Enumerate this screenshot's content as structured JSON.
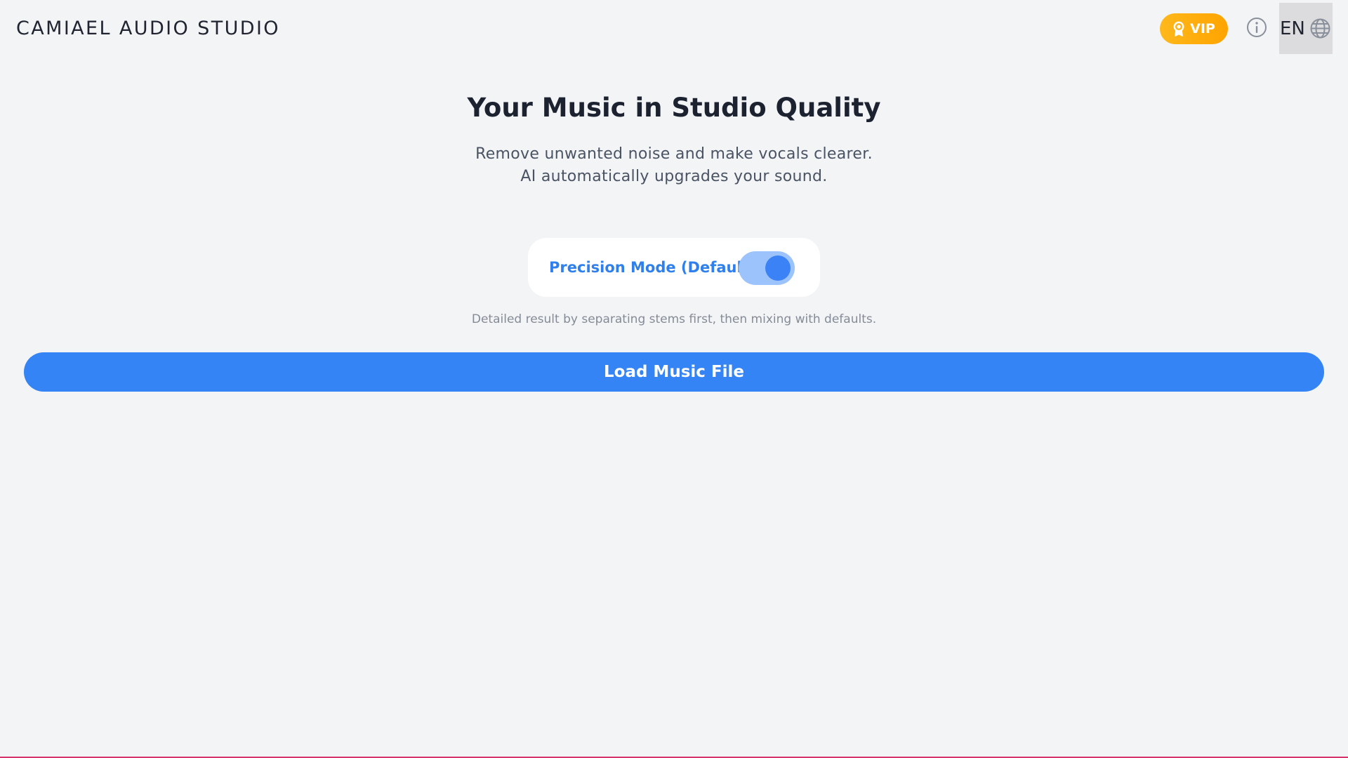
{
  "header": {
    "app_title": "CAMIAEL AUDIO STUDIO",
    "vip_label": "VIP",
    "vip_icon": "award-icon",
    "info_icon": "info-icon",
    "language_code": "EN",
    "language_icon": "globe-icon"
  },
  "hero": {
    "title": "Your Music in Studio Quality",
    "subtitle_line1": "Remove unwanted noise and make vocals clearer.",
    "subtitle_line2": "AI automatically upgrades your sound."
  },
  "mode": {
    "label": "Precision Mode (Default)",
    "enabled": true,
    "description": "Detailed result by separating stems first, then mixing with defaults."
  },
  "actions": {
    "load_label": "Load Music File"
  },
  "colors": {
    "accent": "#3584f5",
    "accent_text": "#2f80ed",
    "vip_gradient_start": "#ffb81c",
    "vip_gradient_end": "#ffa400",
    "background": "#f3f4f6"
  }
}
